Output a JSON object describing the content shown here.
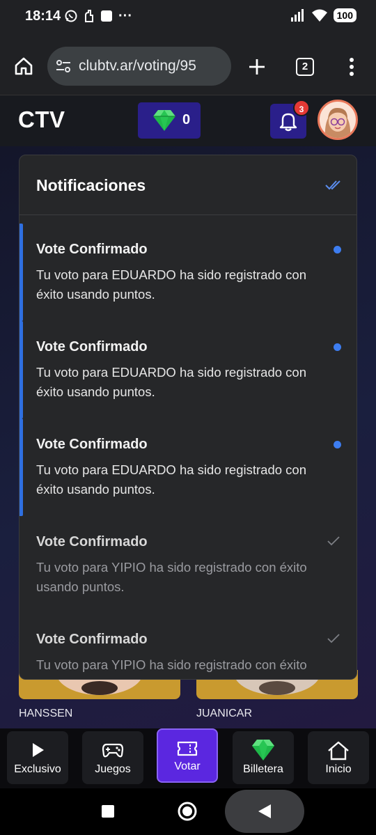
{
  "status_bar": {
    "time": "18:14",
    "overflow": "···",
    "battery": "100"
  },
  "browser": {
    "url": "clubtv.ar/voting/95",
    "tab_count": "2"
  },
  "header": {
    "logo": "CTV",
    "points": "0",
    "notification_badge": "3"
  },
  "notifications": {
    "title": "Notificaciones",
    "items": [
      {
        "title": "Vote Confirmado",
        "body": "Tu voto para EDUARDO ha sido registrado con éxito usando puntos.",
        "read": false
      },
      {
        "title": "Vote Confirmado",
        "body": "Tu voto para EDUARDO ha sido registrado con éxito usando puntos.",
        "read": false
      },
      {
        "title": "Vote Confirmado",
        "body": "Tu voto para EDUARDO ha sido registrado con éxito usando puntos.",
        "read": false
      },
      {
        "title": "Vote Confirmado",
        "body": "Tu voto para YIPIO ha sido registrado con éxito usando puntos.",
        "read": true
      },
      {
        "title": "Vote Confirmado",
        "body": "Tu voto para YIPIO ha sido registrado con éxito usando puntos.",
        "read": true
      }
    ]
  },
  "cards": {
    "left_name": "HANSSEN",
    "right_name": "JUANICAR"
  },
  "bottom_nav": {
    "items": [
      {
        "label": "Exclusivo",
        "icon": "play-icon"
      },
      {
        "label": "Juegos",
        "icon": "gamepad-icon"
      },
      {
        "label": "Votar",
        "icon": "ticket-icon",
        "active": true
      },
      {
        "label": "Billetera",
        "icon": "gem-icon"
      },
      {
        "label": "Inicio",
        "icon": "home-icon"
      }
    ]
  },
  "colors": {
    "accent_purple": "#5b27e0",
    "header_box": "#2a1f8a",
    "unread_blue": "#3d7df0",
    "badge_red": "#e53935",
    "gem_green": "#22c55e"
  }
}
